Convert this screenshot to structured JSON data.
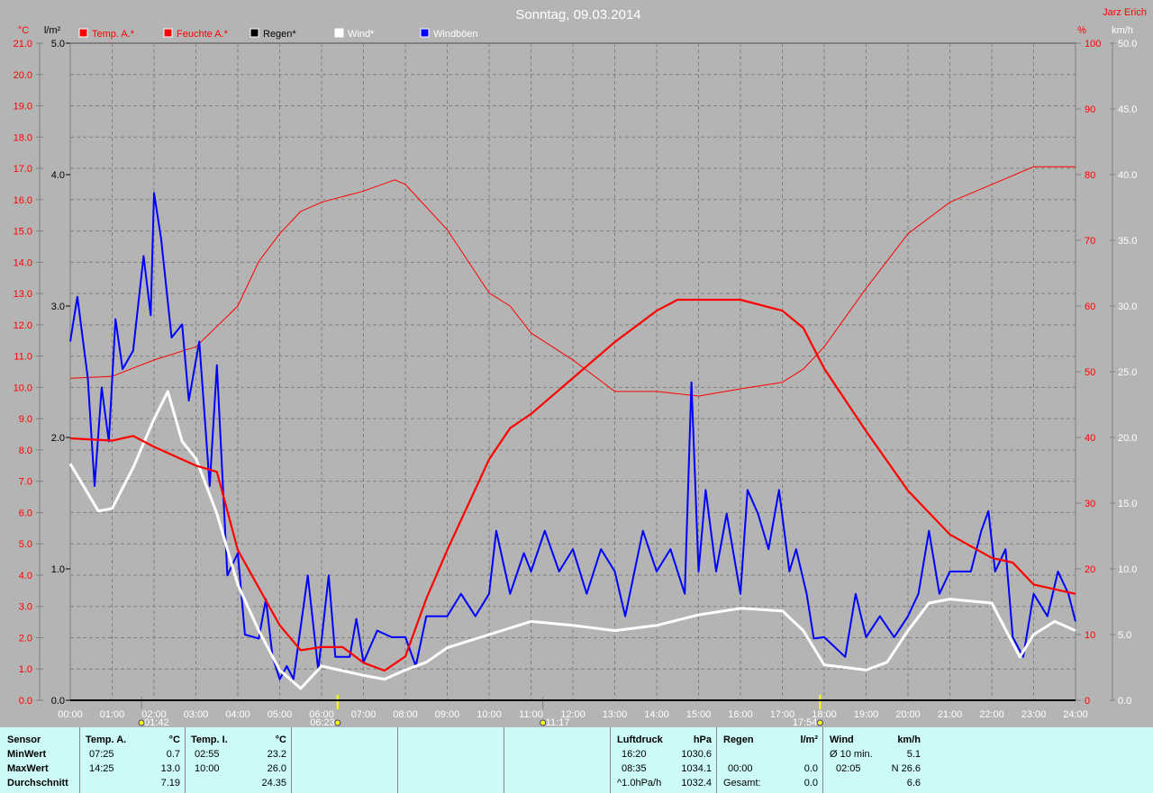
{
  "header": {
    "title": "Sonntag, 09.03.2014",
    "author": "Jarz Erich",
    "unit_temp": "°C",
    "unit_rain": "l/m²",
    "unit_hum": "%",
    "unit_wind": "km/h"
  },
  "chart_data": {
    "type": "line",
    "title": "Sonntag, 09.03.2014",
    "xlabel": "",
    "x_ticks": [
      "00:00",
      "01:00",
      "02:00",
      "03:00",
      "04:00",
      "05:00",
      "06:00",
      "07:00",
      "08:00",
      "09:00",
      "10:00",
      "11:00",
      "12:00",
      "13:00",
      "14:00",
      "15:00",
      "16:00",
      "17:00",
      "18:00",
      "19:00",
      "20:00",
      "21:00",
      "22:00",
      "23:00",
      "24:00"
    ],
    "xlim": [
      0,
      24
    ],
    "axes": {
      "temp": {
        "label": "°C",
        "range": [
          0,
          21
        ],
        "ticks": [
          "0.0",
          "1.0",
          "2.0",
          "3.0",
          "4.0",
          "5.0",
          "6.0",
          "7.0",
          "8.0",
          "9.0",
          "10.0",
          "11.0",
          "12.0",
          "13.0",
          "14.0",
          "15.0",
          "16.0",
          "17.0",
          "18.0",
          "19.0",
          "20.0",
          "21.0"
        ]
      },
      "rain": {
        "label": "l/m²",
        "range": [
          0,
          5
        ],
        "ticks": [
          "0.0",
          "1.0",
          "2.0",
          "3.0",
          "4.0",
          "5.0"
        ]
      },
      "humidity": {
        "label": "%",
        "range": [
          0,
          100
        ],
        "ticks": [
          "0",
          "10",
          "20",
          "30",
          "40",
          "50",
          "60",
          "70",
          "80",
          "90",
          "100"
        ]
      },
      "wind": {
        "label": "km/h",
        "range": [
          0,
          50
        ],
        "ticks": [
          "0.0",
          "5.0",
          "10.0",
          "15.0",
          "20.0",
          "25.0",
          "30.0",
          "35.0",
          "40.0",
          "45.0",
          "50.0"
        ]
      }
    },
    "grid": true,
    "legend_placement": "top-left",
    "series": [
      {
        "name": "Temp. A.*",
        "axis": "temp",
        "color": "#ff0000",
        "width": 2.2,
        "x": [
          0,
          1,
          1.5,
          2,
          3,
          3.5,
          4,
          5,
          5.5,
          6,
          6.5,
          7,
          7.5,
          8,
          8.5,
          9,
          10,
          10.5,
          11,
          12,
          13,
          14,
          14.5,
          15,
          16,
          17,
          17.5,
          18,
          19,
          20,
          21,
          22,
          22.5,
          23,
          24
        ],
        "y": [
          8.37,
          8.3,
          8.45,
          8.1,
          7.5,
          7.3,
          4.8,
          2.4,
          1.6,
          1.7,
          1.7,
          1.2,
          0.95,
          1.4,
          3.25,
          4.8,
          7.7,
          8.7,
          9.15,
          10.3,
          11.45,
          12.45,
          12.8,
          12.8,
          12.8,
          12.45,
          11.9,
          10.6,
          8.6,
          6.7,
          5.3,
          4.55,
          4.4,
          3.7,
          3.4
        ]
      },
      {
        "name": "Feuchte A.*",
        "axis": "humidity",
        "color": "#ff0000",
        "width": 1,
        "x": [
          0,
          1,
          2,
          3,
          4,
          4.5,
          5,
          5.5,
          6,
          7,
          7.75,
          8,
          9,
          10,
          10.5,
          11,
          12,
          13,
          14,
          15,
          16,
          17,
          17.5,
          18,
          19,
          20,
          21,
          22,
          23,
          24
        ],
        "y": [
          49,
          49.3,
          51.8,
          53.8,
          60,
          66.8,
          71,
          74.4,
          75.8,
          77.5,
          79.2,
          78.5,
          71.6,
          62,
          60,
          55.9,
          51.8,
          47,
          47,
          46.3,
          47.4,
          48.4,
          50.4,
          53.8,
          62.7,
          71,
          75.8,
          78.5,
          81.2,
          81.2
        ]
      },
      {
        "name": "Regen*",
        "axis": "rain",
        "color": "#000000",
        "width": 2,
        "x": [
          0,
          24
        ],
        "y": [
          0,
          0
        ]
      },
      {
        "name": "Wind*",
        "axis": "wind",
        "color": "#ffffff",
        "width": 3,
        "x": [
          0,
          0.67,
          1,
          1.5,
          2,
          2.33,
          2.67,
          3,
          3.5,
          4,
          4.5,
          5,
          5.5,
          6,
          7,
          7.5,
          8,
          8.5,
          9,
          10,
          11,
          12,
          13,
          14,
          15,
          16,
          17,
          17.5,
          18,
          19,
          19.5,
          20,
          20.5,
          21,
          22,
          22.67,
          23,
          23.5,
          24
        ],
        "y": [
          18,
          14.4,
          14.6,
          17.7,
          21.4,
          23.5,
          19.7,
          18.4,
          14.2,
          8.8,
          5.3,
          2.3,
          0.9,
          2.6,
          1.9,
          1.6,
          2.3,
          2.9,
          4,
          5,
          6,
          5.7,
          5.3,
          5.7,
          6.5,
          7,
          6.8,
          5.3,
          2.7,
          2.3,
          2.9,
          5.3,
          7.4,
          7.7,
          7.4,
          3.3,
          5,
          6,
          5.3
        ]
      },
      {
        "name": "Windböen",
        "axis": "wind",
        "color": "#0000ff",
        "width": 2,
        "x": [
          0,
          0.17,
          0.42,
          0.58,
          0.75,
          0.92,
          1.08,
          1.25,
          1.5,
          1.75,
          1.92,
          2,
          2.17,
          2.42,
          2.67,
          2.83,
          3.08,
          3.33,
          3.5,
          3.75,
          4,
          4.17,
          4.5,
          4.67,
          4.83,
          5,
          5.17,
          5.33,
          5.67,
          5.92,
          6.17,
          6.33,
          6.67,
          6.83,
          7,
          7.33,
          7.67,
          8,
          8.25,
          8.5,
          9,
          9.33,
          9.67,
          10,
          10.17,
          10.5,
          10.83,
          11,
          11.33,
          11.67,
          12,
          12.33,
          12.67,
          13,
          13.25,
          13.67,
          14,
          14.33,
          14.67,
          14.83,
          15,
          15.17,
          15.42,
          15.67,
          16,
          16.17,
          16.42,
          16.67,
          16.92,
          17.17,
          17.33,
          17.58,
          17.75,
          18,
          18.5,
          18.75,
          19,
          19.33,
          19.67,
          20,
          20.25,
          20.5,
          20.75,
          21,
          21.5,
          21.75,
          21.92,
          22.08,
          22.33,
          22.5,
          22.75,
          23,
          23.33,
          23.58,
          23.83,
          24
        ],
        "y": [
          27.3,
          30.7,
          24.5,
          16.3,
          23.8,
          19.7,
          29,
          25.2,
          26.6,
          33.8,
          29.3,
          38.6,
          35.1,
          27.6,
          28.6,
          22.8,
          27.3,
          16.3,
          25.5,
          9.5,
          11.2,
          5,
          4.7,
          7.7,
          3.3,
          1.6,
          2.6,
          1.6,
          9.5,
          2.3,
          9.5,
          3.3,
          3.3,
          6.2,
          2.9,
          5.3,
          4.8,
          4.8,
          2.6,
          6.4,
          6.4,
          8.1,
          6.4,
          8.1,
          12.9,
          8.1,
          11.2,
          9.8,
          12.9,
          9.8,
          11.5,
          8.1,
          11.5,
          9.8,
          6.4,
          12.9,
          9.8,
          11.5,
          8.1,
          24.2,
          9.8,
          16,
          9.8,
          14.2,
          8.1,
          16,
          14.2,
          11.5,
          16,
          9.8,
          11.5,
          8.1,
          4.7,
          4.8,
          3.3,
          8.1,
          4.8,
          6.4,
          4.8,
          6.4,
          8.1,
          12.9,
          8.1,
          9.8,
          9.8,
          12.9,
          14.4,
          9.8,
          11.5,
          4.8,
          3.3,
          8.1,
          6.4,
          9.8,
          8.1,
          6
        ]
      }
    ],
    "markers": [
      {
        "name": "moonset",
        "time": "01:42",
        "x": 1.7,
        "color": "#404040"
      },
      {
        "name": "sunrise",
        "time": "06:23",
        "x": 6.383,
        "color": "#ffff00"
      },
      {
        "name": "moonrise",
        "time": "11:17",
        "x": 11.283,
        "color": "#404040"
      },
      {
        "name": "sunset",
        "time": "17:54",
        "x": 17.9,
        "color": "#ffff00"
      }
    ]
  },
  "table": {
    "temp_a": {
      "h1": "Sensor",
      "h2": "Temp. A.",
      "h3": "°C",
      "rows": [
        [
          "MinWert",
          "07:25",
          "0.7"
        ],
        [
          "MaxWert",
          "14:25",
          "13.0"
        ],
        [
          "Durchschnitt",
          "",
          "7.19"
        ]
      ]
    },
    "temp_i": {
      "h2": "Temp. I.",
      "h3": "°C",
      "rows": [
        [
          "02:55",
          "23.2"
        ],
        [
          "10:00",
          "26.0"
        ],
        [
          "",
          "24.35"
        ]
      ]
    },
    "pressure": {
      "h2": "Luftdruck",
      "h3": "hPa",
      "rows": [
        [
          "16:20",
          "1030.6"
        ],
        [
          "08:35",
          "1034.1"
        ],
        [
          "^1.0hPa/h",
          "1032.4"
        ]
      ]
    },
    "rain": {
      "h2": "Regen",
      "h3": "l/m²",
      "rows": [
        [
          "",
          ""
        ],
        [
          "00:00",
          "0.0"
        ],
        [
          "Gesamt:",
          "0.0"
        ]
      ]
    },
    "wind": {
      "h2": "Wind",
      "h3": "km/h",
      "rows": [
        [
          "Ø 10 min.",
          "5.1"
        ],
        [
          "02:05",
          "N 26.6"
        ],
        [
          "",
          "6.6"
        ]
      ]
    }
  }
}
